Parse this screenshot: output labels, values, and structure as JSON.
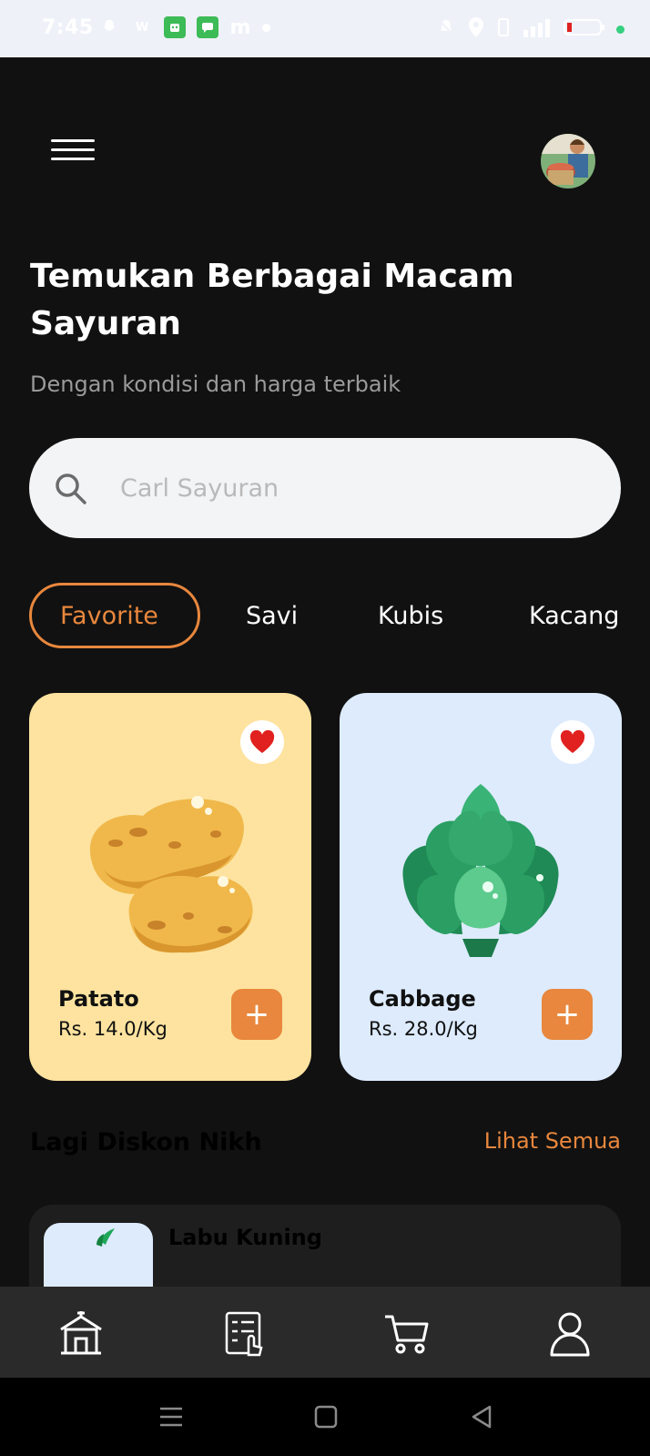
{
  "status_bar": {
    "time": "7:45"
  },
  "header": {
    "title": "Temukan Berbagai Macam Sayuran",
    "subtitle": "Dengan kondisi dan harga terbaik"
  },
  "search": {
    "placeholder": "Carl Sayuran"
  },
  "categories": [
    {
      "label": "Favorite",
      "active": true
    },
    {
      "label": "Savi",
      "active": false
    },
    {
      "label": "Kubis",
      "active": false
    },
    {
      "label": "Kacang",
      "active": false
    }
  ],
  "products": [
    {
      "name": "Patato",
      "price": "Rs. 14.0/Kg",
      "favorite": true,
      "add_label": "+",
      "bg_color": "#fde39f",
      "icon": "potato-icon"
    },
    {
      "name": "Cabbage",
      "price": "Rs. 28.0/Kg",
      "favorite": true,
      "add_label": "+",
      "bg_color": "#ddebfd",
      "icon": "cabbage-icon"
    }
  ],
  "discount_section": {
    "title": "Lagi Diskon Nikh",
    "see_all": "Lihat Semua",
    "items": [
      {
        "name": "Labu Kuning"
      }
    ]
  },
  "bottom_nav": [
    {
      "icon": "home-icon",
      "active": true
    },
    {
      "icon": "orders-icon",
      "active": false
    },
    {
      "icon": "cart-icon",
      "active": false
    },
    {
      "icon": "profile-icon",
      "active": false
    }
  ],
  "colors": {
    "accent": "#e8873d",
    "background": "#111111",
    "heart": "#e0211f"
  }
}
